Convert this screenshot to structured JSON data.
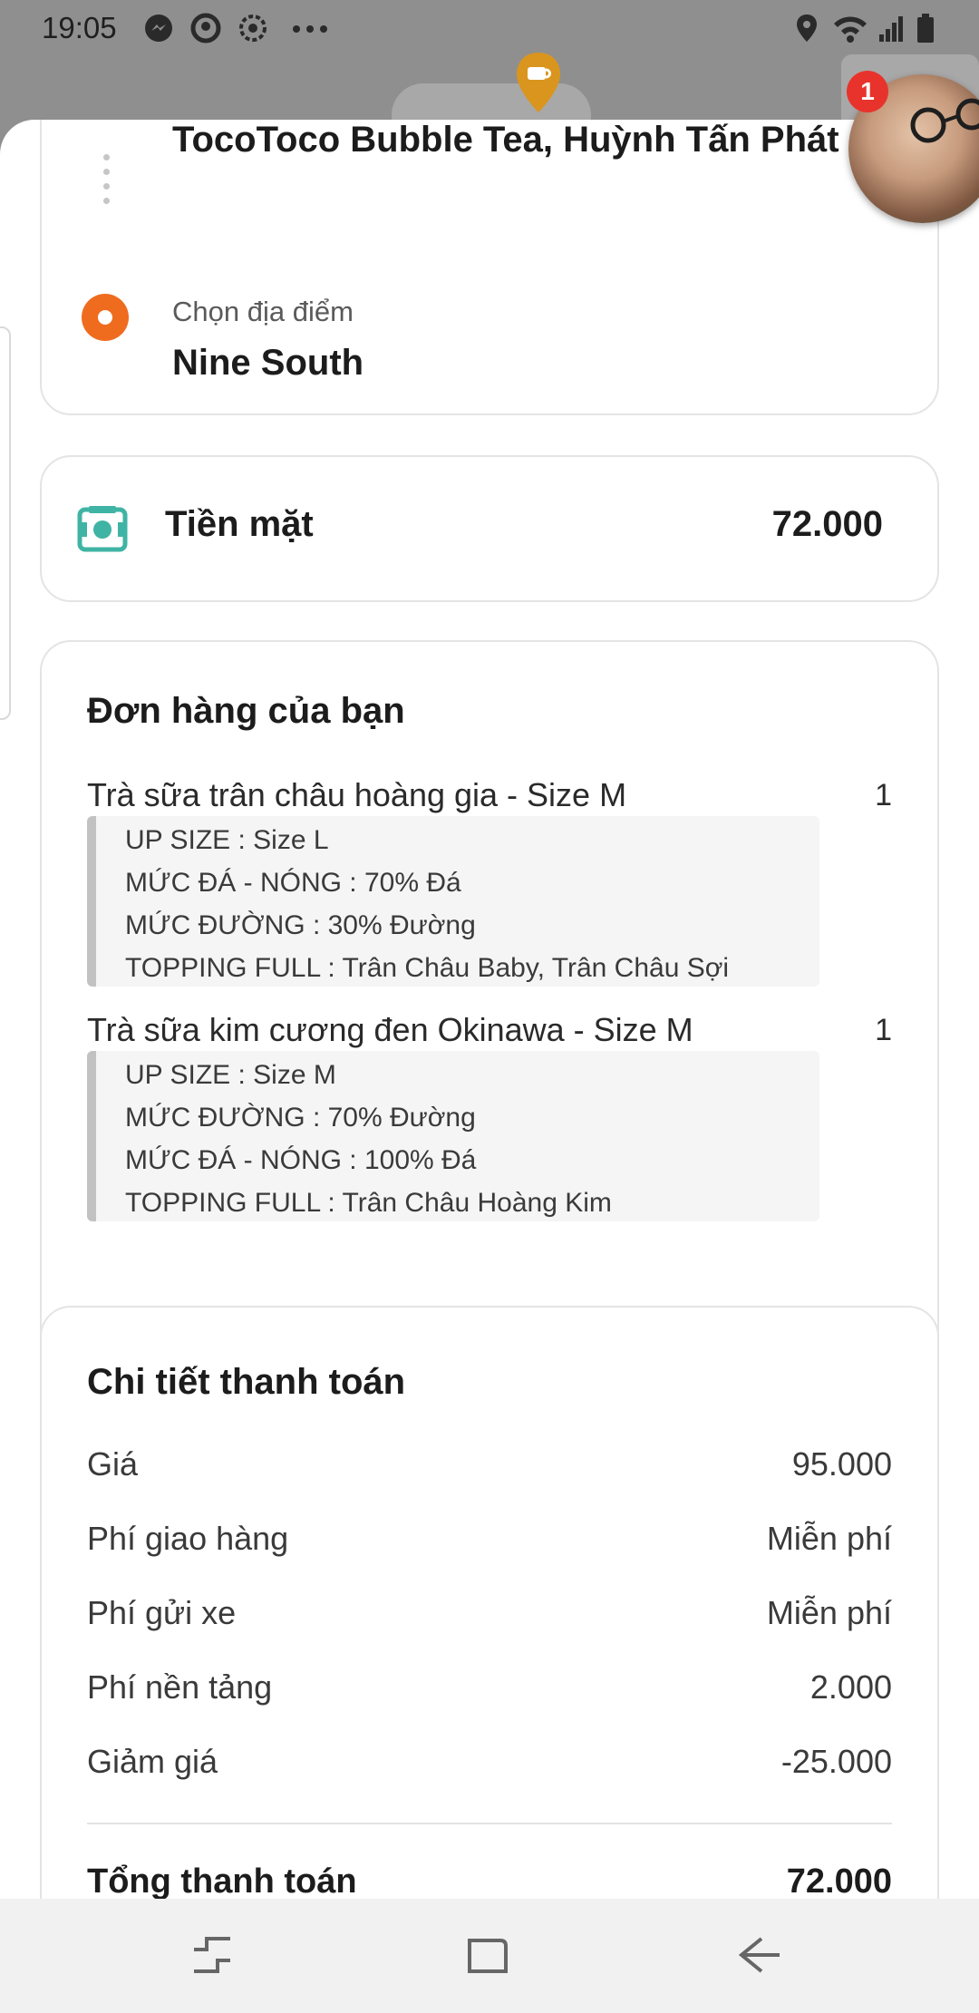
{
  "status_bar": {
    "time": "19:05",
    "left_icons": [
      "messenger-icon",
      "circle-app-icon",
      "settings-gear-icon",
      "more-dots-icon"
    ],
    "right_icons": [
      "location-icon",
      "wifi-icon",
      "signal-icon",
      "battery-icon"
    ]
  },
  "chat_head": {
    "badge_count": "1"
  },
  "route": {
    "origin_name": "TocoToco Bubble Tea, Huỳnh Tấn Phát",
    "destination_label": "Chọn địa điểm",
    "destination_value": "Nine South"
  },
  "payment": {
    "method_icon": "cash-icon",
    "method_label": "Tiền mặt",
    "amount": "72.000"
  },
  "order": {
    "title": "Đơn hàng của bạn",
    "items": [
      {
        "name": "Trà sữa trân châu hoàng gia - Size M",
        "qty": "1",
        "options": [
          "UP SIZE : Size L",
          "MỨC ĐÁ - NÓNG : 70% Đá",
          "MỨC ĐƯỜNG : 30% Đường",
          "TOPPING FULL : Trân Châu Baby, Trân Châu Sợi"
        ]
      },
      {
        "name": "Trà sữa kim cương đen Okinawa - Size M",
        "qty": "1",
        "options": [
          "UP SIZE : Size M",
          "MỨC ĐƯỜNG : 70% Đường",
          "MỨC ĐÁ - NÓNG : 100% Đá",
          "TOPPING FULL : Trân Châu Hoàng Kim"
        ]
      }
    ]
  },
  "payment_details": {
    "title": "Chi tiết thanh toán",
    "rows": [
      {
        "label": "Giá",
        "value": "95.000"
      },
      {
        "label": "Phí giao hàng",
        "value": "Miễn phí"
      },
      {
        "label": "Phí gửi xe",
        "value": "Miễn phí"
      },
      {
        "label": "Phí nền tảng",
        "value": "2.000"
      },
      {
        "label": "Giảm giá",
        "value": "-25.000"
      }
    ],
    "total_label": "Tổng thanh toán",
    "total_value": "72.000"
  },
  "nav_bar": {
    "buttons": [
      "recent-apps-icon",
      "home-icon",
      "back-icon"
    ]
  },
  "colors": {
    "accent_orange": "#ef6c1e",
    "cash_teal": "#3fb4a4",
    "badge_red": "#e8332c",
    "pin_gold": "#d9951e"
  }
}
